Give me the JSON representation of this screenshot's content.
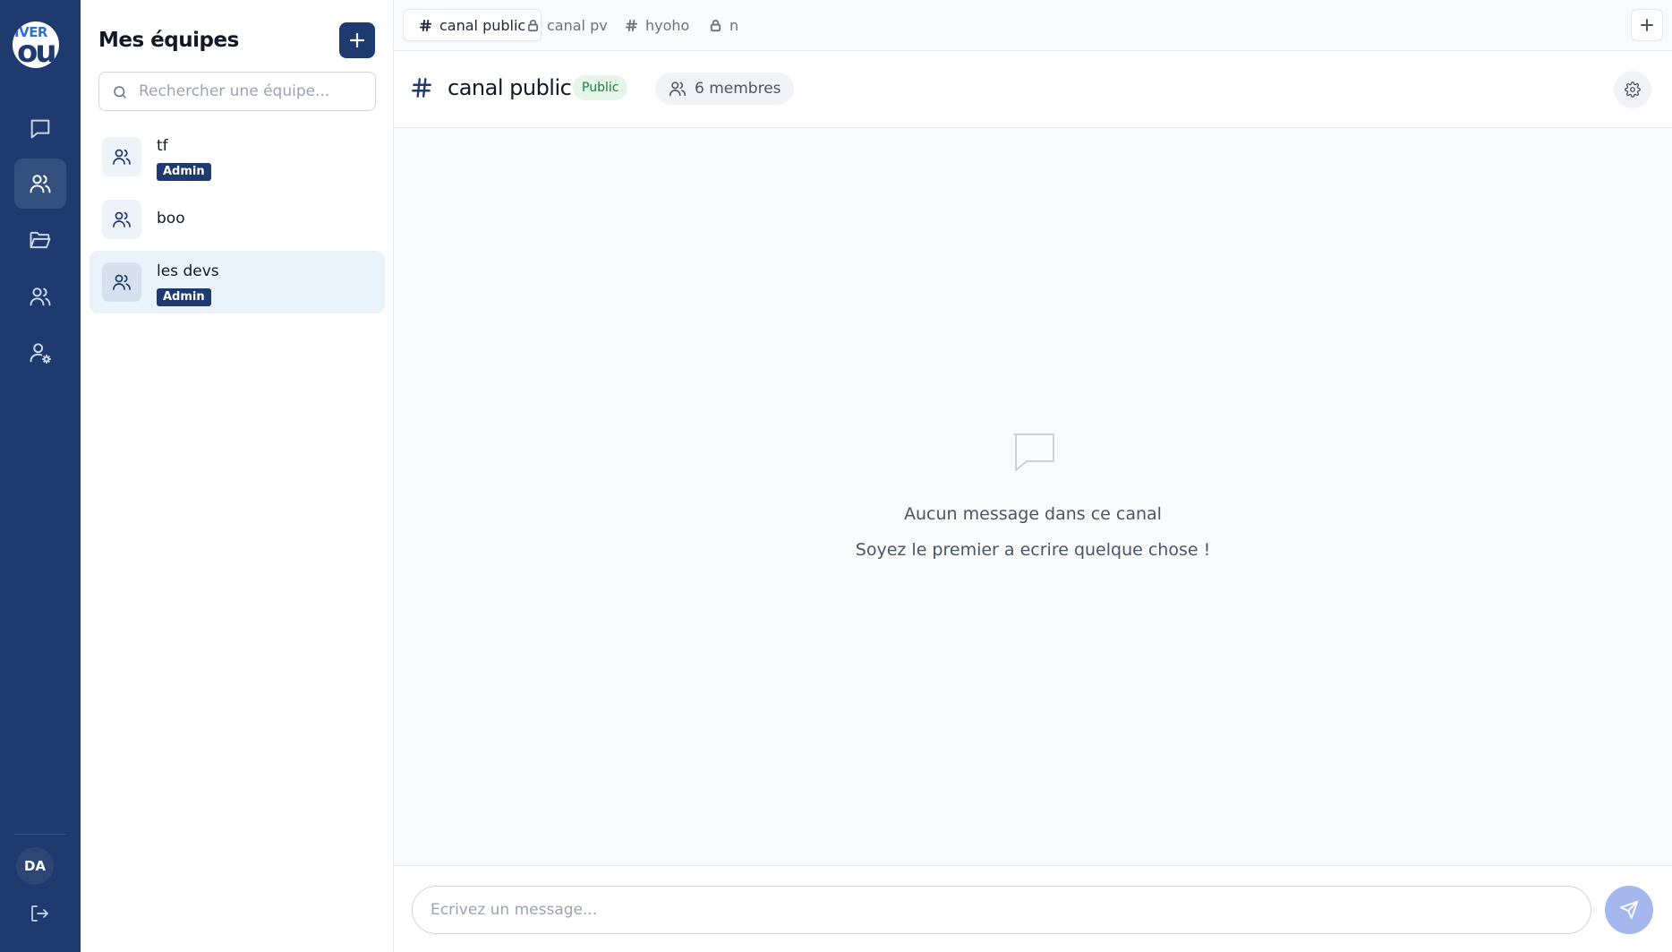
{
  "app": {
    "logo_top": "IVER",
    "logo_bottom": "ou"
  },
  "rail": {
    "items": [
      {
        "name": "messages",
        "icon": "chat-bubble-icon",
        "active": false
      },
      {
        "name": "teams",
        "icon": "users-icon",
        "active": true
      },
      {
        "name": "files",
        "icon": "folder-open-icon",
        "active": false
      },
      {
        "name": "contacts",
        "icon": "users-icon",
        "active": false
      },
      {
        "name": "user-settings",
        "icon": "user-cog-icon",
        "active": false
      }
    ],
    "user_initials": "DA",
    "logout_icon": "logout-icon"
  },
  "teams_panel": {
    "title": "Mes équipes",
    "add_button_icon": "plus-icon",
    "search_placeholder": "Rechercher une équipe...",
    "teams": [
      {
        "name": "tf",
        "role": "Admin",
        "selected": false
      },
      {
        "name": "boo",
        "role": "",
        "selected": false
      },
      {
        "name": "les devs",
        "role": "Admin",
        "selected": true
      }
    ]
  },
  "tabs": {
    "items": [
      {
        "label": "canal public",
        "icon": "hash-icon",
        "active": true
      },
      {
        "label": "canal pv",
        "icon": "lock-icon",
        "active": false
      },
      {
        "label": "hyoho",
        "icon": "hash-icon",
        "active": false
      },
      {
        "label": "n",
        "icon": "lock-icon",
        "active": false
      }
    ],
    "add_icon": "plus-icon"
  },
  "channel": {
    "title": "canal public",
    "visibility": "Public",
    "members": "6 membres",
    "settings_icon": "gear-icon"
  },
  "messages": {
    "empty_title": "Aucun message dans ce canal",
    "empty_subtitle": "Soyez le premier a ecrire quelque chose !"
  },
  "composer": {
    "placeholder": "Ecrivez un message...",
    "send_icon": "send-icon"
  },
  "colors": {
    "brand": "#1e3a6e",
    "public_badge_bg": "#e5f5ea",
    "public_badge_text": "#15803d",
    "send_button": "#a5b8ee",
    "selected_team_bg": "#eaf2fc"
  }
}
